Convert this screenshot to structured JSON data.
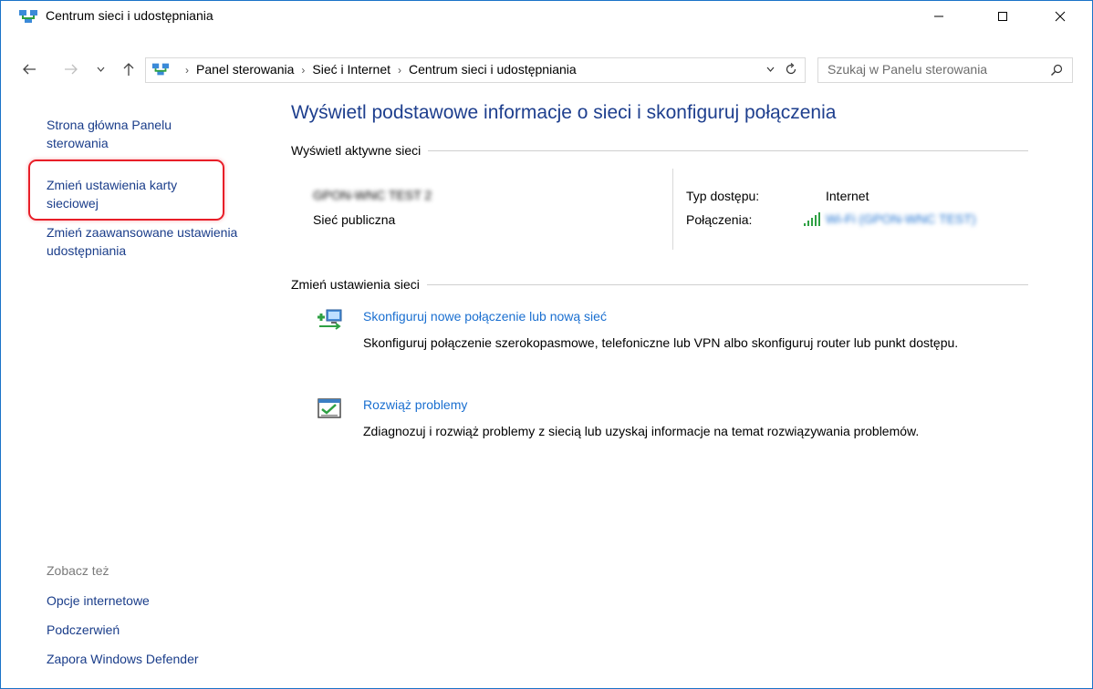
{
  "window": {
    "title": "Centrum sieci i udostępniania"
  },
  "address": {
    "crumbs": [
      "Panel sterowania",
      "Sieć i Internet",
      "Centrum sieci i udostępniania"
    ],
    "search_placeholder": "Szukaj w Panelu sterowania"
  },
  "left": {
    "home": "Strona główna Panelu sterowania",
    "adapter": "Zmień ustawienia karty sieciowej",
    "sharing": "Zmień zaawansowane ustawienia udostępniania",
    "see_also_title": "Zobacz też",
    "see_also": [
      "Opcje internetowe",
      "Podczerwień",
      "Zapora Windows Defender"
    ]
  },
  "main": {
    "title": "Wyświetl podstawowe informacje o sieci i skonfiguruj połączenia",
    "active_title": "Wyświetl aktywne sieci",
    "network": {
      "name": "GPON-WNC TEST 2",
      "type": "Sieć publiczna",
      "access_label": "Typ dostępu:",
      "access_value": "Internet",
      "conn_label": "Połączenia:",
      "conn_value": "Wi-Fi (GPON-WNC TEST)"
    },
    "change_title": "Zmień ustawienia sieci",
    "tasks": [
      {
        "link": "Skonfiguruj nowe połączenie lub nową sieć",
        "desc": "Skonfiguruj połączenie szerokopasmowe, telefoniczne lub VPN albo skonfiguruj router lub punkt dostępu."
      },
      {
        "link": "Rozwiąż problemy",
        "desc": "Zdiagnozuj i rozwiąż problemy z siecią lub uzyskaj informacje na temat rozwiązywania problemów."
      }
    ]
  },
  "colors": {
    "link": "#1a3d8a",
    "task_link": "#1a6fd0",
    "title": "#1e3f8e",
    "highlight": "#e81e28",
    "window_border": "#1a73c8"
  },
  "icons": [
    "network-center-icon",
    "minimize-icon",
    "maximize-icon",
    "close-icon",
    "back-arrow-icon",
    "forward-arrow-icon",
    "recent-chevron-icon",
    "up-arrow-icon",
    "refresh-icon",
    "search-icon",
    "wifi-signal-icon",
    "new-connection-icon",
    "troubleshoot-icon"
  ]
}
